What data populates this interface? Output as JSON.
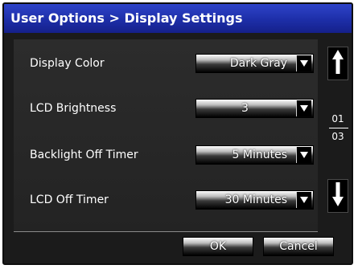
{
  "title": "User Options > Display Settings",
  "settings": [
    {
      "label": "Display Color",
      "value": "Dark Gray"
    },
    {
      "label": "LCD Brightness",
      "value": "3"
    },
    {
      "label": "Backlight Off Timer",
      "value": "5 Minutes"
    },
    {
      "label": "LCD Off Timer",
      "value": "30 Minutes"
    }
  ],
  "pager": {
    "current": "01",
    "total": "03"
  },
  "buttons": {
    "ok": "OK",
    "cancel": "Cancel"
  },
  "icons": {
    "dropdown": "chevron-down-icon",
    "scroll_up": "arrow-up-icon",
    "scroll_down": "arrow-down-icon"
  },
  "colors": {
    "title_bar": "#1d2ea8",
    "background": "#1b1b1b",
    "panel": "#2a2a2a"
  }
}
